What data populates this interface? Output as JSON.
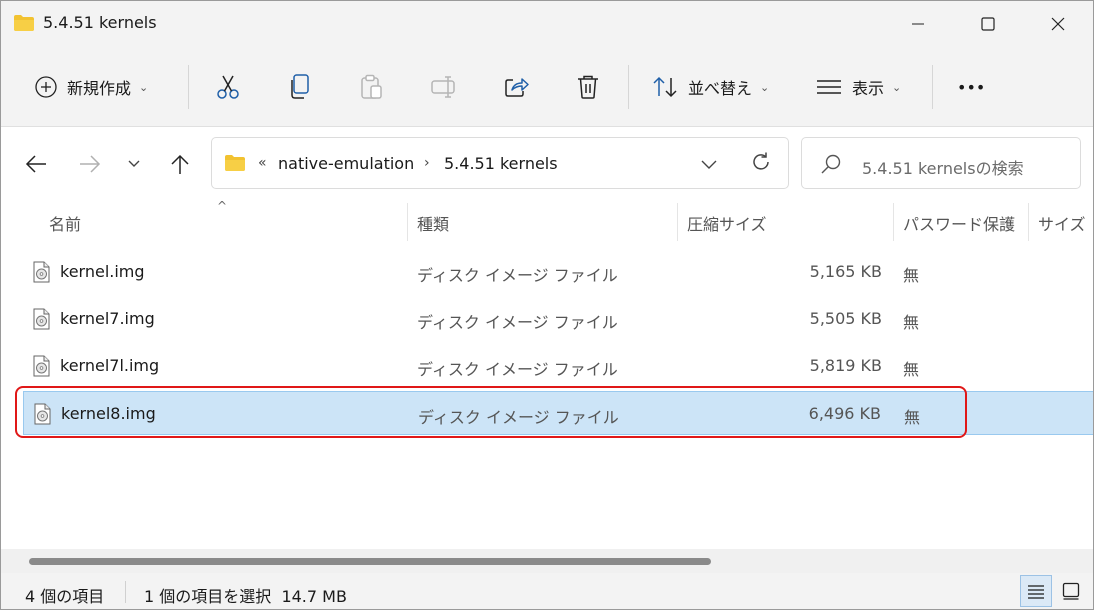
{
  "window": {
    "title": "5.4.51 kernels"
  },
  "commandbar": {
    "new_label": "新規作成",
    "sort_label": "並べ替え",
    "view_label": "表示",
    "more_label": "•••"
  },
  "navigation": {
    "overflow": "«",
    "breadcrumbs": [
      "native-emulation",
      "5.4.51 kernels"
    ],
    "crumb_separator": "›",
    "search_placeholder": "5.4.51 kernelsの検索"
  },
  "columns": {
    "name": "名前",
    "type": "種類",
    "compressed_size": "圧縮サイズ",
    "password": "パスワード保護",
    "size": "サイズ"
  },
  "files": [
    {
      "name": "kernel.img",
      "type": "ディスク イメージ ファイル",
      "compressed_size": "5,165 KB",
      "password": "無"
    },
    {
      "name": "kernel7.img",
      "type": "ディスク イメージ ファイル",
      "compressed_size": "5,505 KB",
      "password": "無"
    },
    {
      "name": "kernel7l.img",
      "type": "ディスク イメージ ファイル",
      "compressed_size": "5,819 KB",
      "password": "無"
    },
    {
      "name": "kernel8.img",
      "type": "ディスク イメージ ファイル",
      "compressed_size": "6,496 KB",
      "password": "無"
    }
  ],
  "selected_file": "kernel8.img",
  "status": {
    "item_count": "4 個の項目",
    "selection": "1 個の項目を選択  14.7 MB"
  },
  "colors": {
    "selection": "#cce4f7",
    "highlight_border": "#e01818",
    "folder": "#f2c230"
  }
}
